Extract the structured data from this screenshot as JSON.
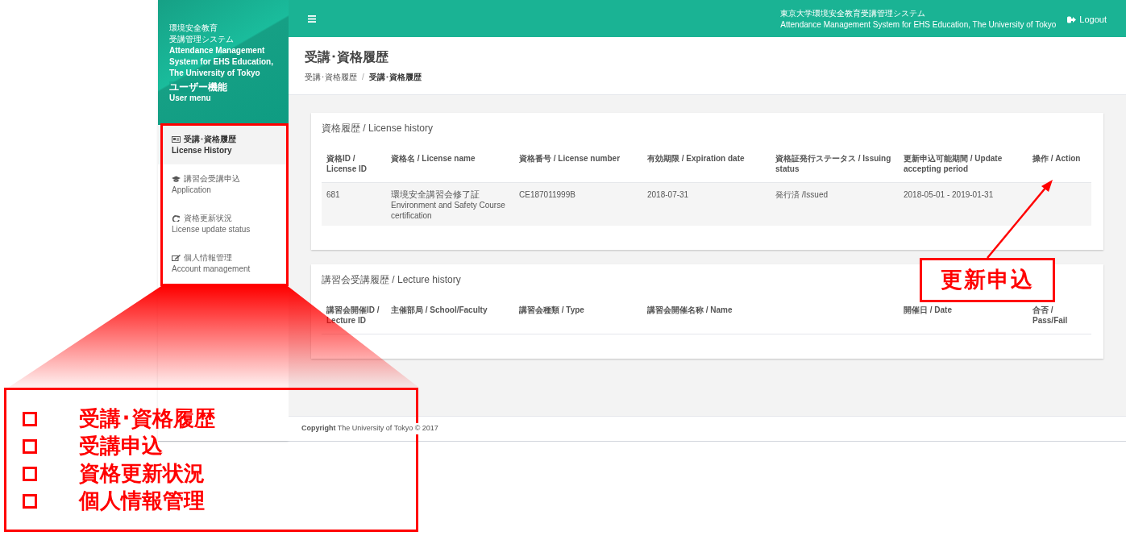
{
  "header": {
    "system_title_ja": "東京大学環境安全教育受講管理システム",
    "system_title_en": "Attendance Management System for EHS Education, The University of Tokyo",
    "logout": "Logout"
  },
  "sidebar": {
    "brand_lines": [
      "環境安全教育",
      "受講管理システム",
      "Attendance Management",
      "System for EHS Education,",
      "The University of Tokyo"
    ],
    "user_menu_ja": "ユーザー機能",
    "user_menu_en": "User menu",
    "items": [
      {
        "kind": "id-card",
        "label_ja": "受講･資格履歴",
        "label_en": "License History",
        "selected": true
      },
      {
        "kind": "graduation-cap",
        "label_ja": "講習会受講申込",
        "label_en": "Application",
        "selected": false
      },
      {
        "kind": "refresh",
        "label_ja": "資格更新状況",
        "label_en": "License update status",
        "selected": false
      },
      {
        "kind": "edit",
        "label_ja": "個人情報管理",
        "label_en": "Account management",
        "selected": false
      }
    ]
  },
  "page": {
    "title": "受講･資格履歴",
    "breadcrumbs": [
      "受講･資格履歴",
      "受講･資格履歴"
    ],
    "breadcrumb_separator": "/"
  },
  "license_panel": {
    "title": "資格履歴 / License history",
    "columns": [
      "資格ID / License ID",
      "資格名 / License name",
      "資格番号 / License number",
      "有効期限 / Expiration date",
      "資格証発行ステータス / Issuing status",
      "更新申込可能期間 / Update accepting period",
      "操作 / Action"
    ],
    "rows": [
      {
        "cells": [
          [
            "681"
          ],
          [
            "環境安全講習会修了証",
            "Environment and Safety Course certification"
          ],
          [
            "CE187011999B"
          ],
          [
            "2018-07-31"
          ],
          [
            "発行済 /Issued"
          ],
          [
            "2018-05-01 - 2019-01-31"
          ],
          []
        ]
      }
    ]
  },
  "lecture_panel": {
    "title": "講習会受講履歴 / Lecture history",
    "columns": [
      "講習会開催ID / Lecture ID",
      "主催部局 / School/Faculty",
      "講習会種類 / Type",
      "講習会開催名称 / Name",
      "開催日 / Date",
      "合否 / Pass/Fail"
    ]
  },
  "footer": {
    "copyright": "**Copyright** The University of Tokyo © 2017"
  },
  "annotations": {
    "menu_callout_items": [
      "受講･資格履歴",
      "受講申込",
      "資格更新状況",
      "個人情報管理"
    ],
    "action_callout": "更新申込"
  }
}
